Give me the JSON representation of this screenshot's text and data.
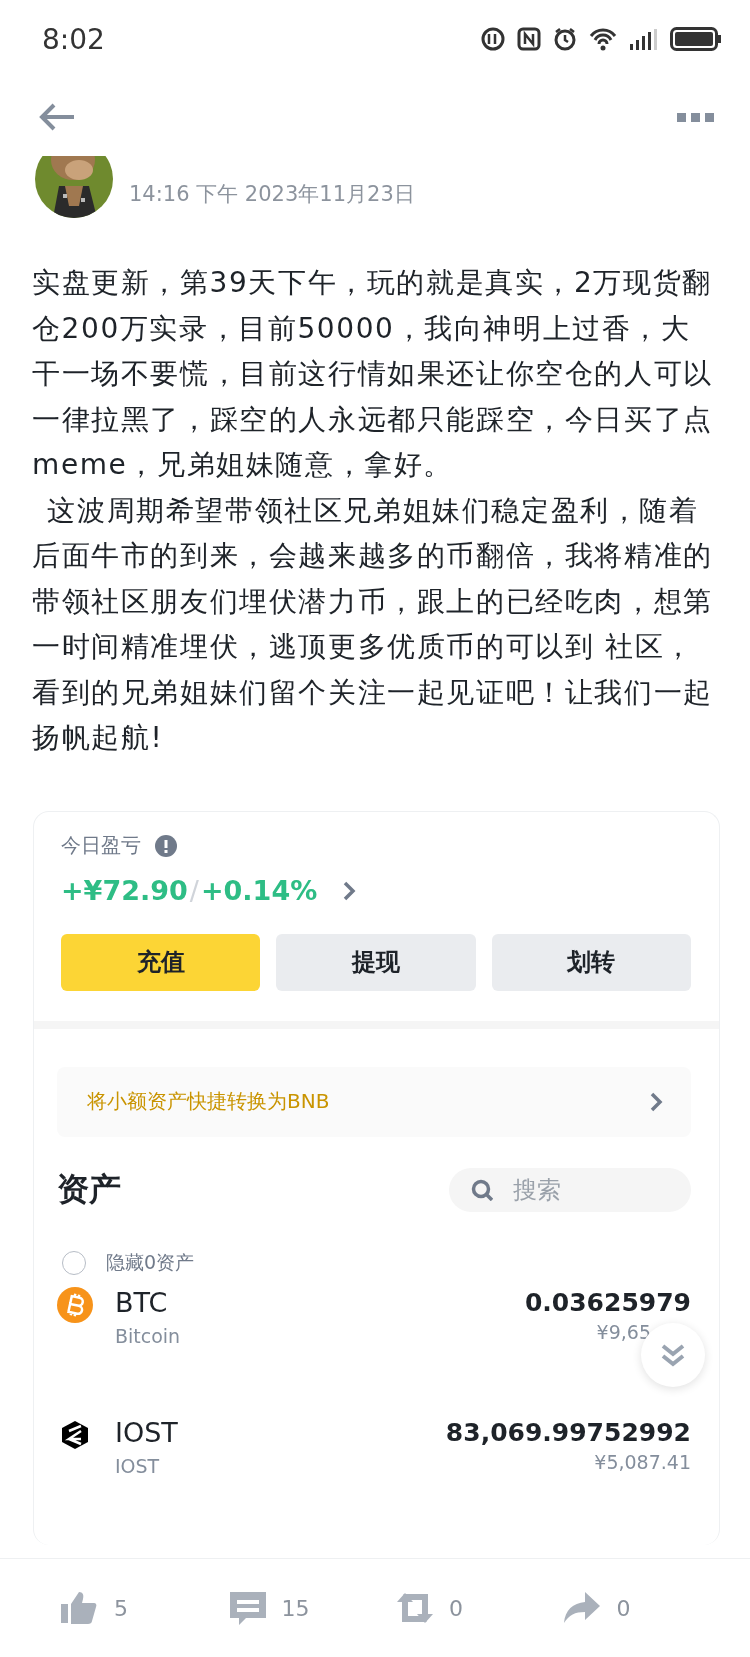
{
  "status_bar": {
    "time": "8:02"
  },
  "post": {
    "date": "14:16 下午 2023年11月23日",
    "paragraphs": [
      {
        "text": "实盘更新，第39天下午，玩的就是真实，2万现货翻仓200万实录，目前50000，我向神明上过香，大干一场不要慌，目前这行情如果还让你空仓的人可以一律拉黑了，踩空的人永远都只能踩空，今日买了点meme，兄弟姐妹随意，拿好。",
        "indent": false
      },
      {
        "text": "这波周期希望带领社区兄弟姐妹们稳定盈利，随着后面牛市的到来，会越来越多的币翻倍，我将精准的带领社区朋友们埋伏潜力币，跟上的已经吃肉，想第一时间精准埋伏，逃顶更多优质币的可以到 社区，看到的兄弟姐妹们留个关注一起见证吧！让我们一起扬帆起航!",
        "indent": true
      }
    ]
  },
  "wallet": {
    "pnl_label": "今日盈亏",
    "pnl": {
      "amount": "+¥72.90",
      "separator": "/",
      "percent": "+0.14%"
    },
    "buttons": [
      {
        "label": "充值",
        "kind": "primary"
      },
      {
        "label": "提现",
        "kind": "secondary"
      },
      {
        "label": "划转",
        "kind": "secondary"
      }
    ],
    "banner": "将小额资产快捷转换为BNB",
    "assets_title": "资产",
    "search": {
      "placeholder": "搜索"
    },
    "hide_zero": {
      "label": "隐藏0资产",
      "checked": false
    },
    "assets": [
      {
        "kind": "btc",
        "symbol": "BTC",
        "name": "Bitcoin",
        "amount": "0.03625979",
        "value": "¥9,65"
      },
      {
        "kind": "iost",
        "symbol": "IOST",
        "name": "IOST",
        "amount": "83,069.99752992",
        "value": "¥5,087.41"
      }
    ]
  },
  "actions": [
    {
      "kind": "like",
      "count": "5"
    },
    {
      "kind": "comment",
      "count": "15"
    },
    {
      "kind": "repost",
      "count": "0"
    },
    {
      "kind": "share",
      "count": "0"
    }
  ]
}
